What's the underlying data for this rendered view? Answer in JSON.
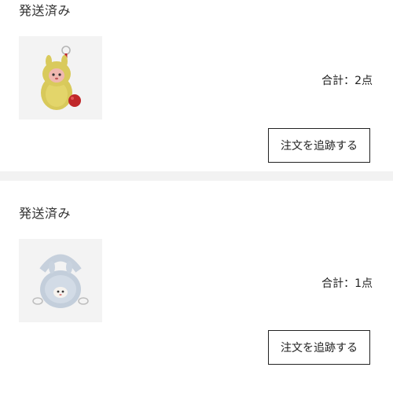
{
  "orders": [
    {
      "status": "発送済み",
      "total_label": "合計：2点",
      "track_button": "注文を追跡する",
      "thumbnail_icon": "yellow-plush-keychain-icon"
    },
    {
      "status": "発送済み",
      "total_label": "合計：1点",
      "track_button": "注文を追跡する",
      "thumbnail_icon": "blue-plush-bag-icon"
    }
  ],
  "colors": {
    "page_background": "#f2f2f2",
    "card_background": "#ffffff",
    "button_border": "#222222",
    "thumbnail_background": "#f3f3f3"
  }
}
